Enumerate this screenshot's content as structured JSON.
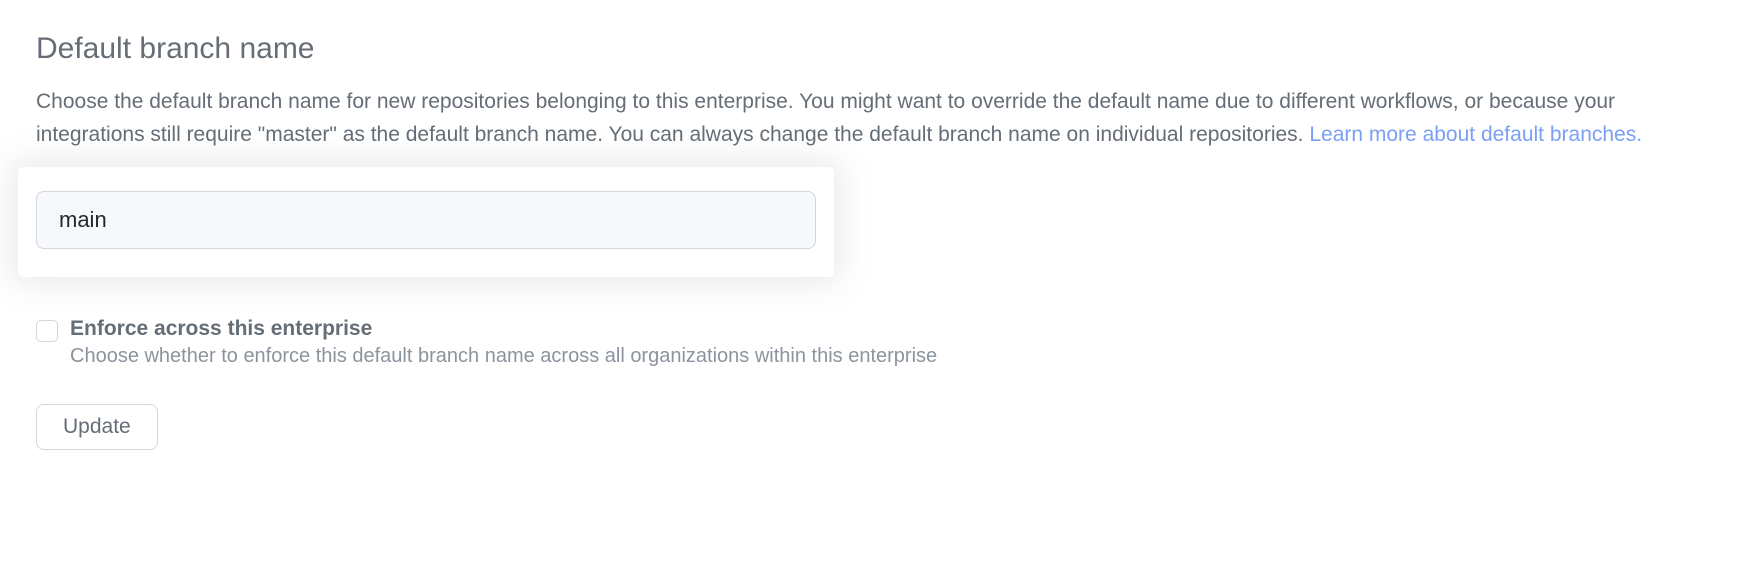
{
  "section": {
    "title": "Default branch name",
    "description": "Choose the default branch name for new repositories belonging to this enterprise. You might want to override the default name due to different workflows, or because your integrations still require \"master\" as the default branch name. You can always change the default branch name on individual repositories. ",
    "learn_more_text": "Learn more about default branches."
  },
  "input": {
    "value": "main"
  },
  "enforce": {
    "label": "Enforce across this enterprise",
    "description": "Choose whether to enforce this default branch name across all organizations within this enterprise"
  },
  "buttons": {
    "update": "Update"
  }
}
